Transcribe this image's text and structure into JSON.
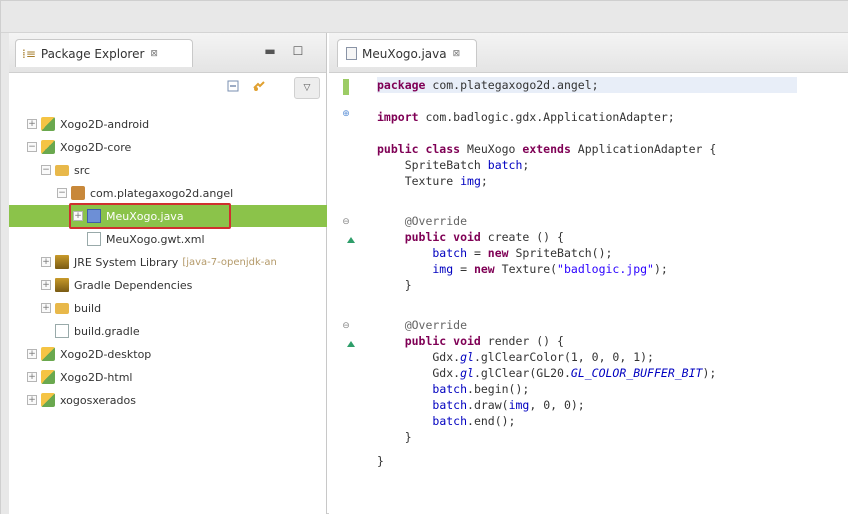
{
  "package_explorer": {
    "tab_label": "Package Explorer",
    "tab_close": "⊠",
    "minimize": "▬",
    "maximize": "☐",
    "toolbar_menu": "▽",
    "tree": [
      {
        "label": "Xogo2D-android",
        "icon": "project-icon",
        "expander": "+"
      },
      {
        "label": "Xogo2D-core",
        "icon": "project-icon",
        "expander": "−"
      },
      {
        "label": "src",
        "icon": "source-folder-icon",
        "expander": "−"
      },
      {
        "label": "com.plategaxogo2d.angel",
        "icon": "package-icon",
        "expander": "−"
      },
      {
        "label": "MeuXogo.java",
        "icon": "java-file-icon",
        "expander": "+",
        "selected": true
      },
      {
        "label": "MeuXogo.gwt.xml",
        "icon": "xml-file-icon",
        "expander": ""
      },
      {
        "label": "JRE System Library",
        "suffix": "[java-7-openjdk-an",
        "icon": "library-icon",
        "expander": "+"
      },
      {
        "label": "Gradle Dependencies",
        "icon": "library-icon",
        "expander": "+"
      },
      {
        "label": "build",
        "icon": "folder-icon",
        "expander": "+"
      },
      {
        "label": "build.gradle",
        "icon": "file-icon",
        "expander": ""
      },
      {
        "label": "Xogo2D-desktop",
        "icon": "project-icon",
        "expander": "+"
      },
      {
        "label": "Xogo2D-html",
        "icon": "project-icon",
        "expander": "+"
      },
      {
        "label": "xogosxerados",
        "icon": "project-icon",
        "expander": "+"
      }
    ]
  },
  "editor": {
    "tab_label": "MeuXogo.java",
    "tab_close": "⊠",
    "code": {
      "l1_kw": "package",
      "l1_rest": " com.plategaxogo2d.angel;",
      "l2_kw": "import",
      "l2_rest": " com.badlogic.gdx.ApplicationAdapter;",
      "l3_kw1": "public class",
      "l3_mid": " MeuXogo ",
      "l3_kw2": "extends",
      "l3_rest": " ApplicationAdapter {",
      "l4_type": "    SpriteBatch ",
      "l4_field": "batch",
      "l4_end": ";",
      "l5_type": "    Texture ",
      "l5_field": "img",
      "l5_end": ";",
      "l6_ann": "    @Override",
      "l7_kw": "    public void",
      "l7_rest": " create () {",
      "l8_field": "        batch",
      "l8_eq": " = ",
      "l8_kw": "new",
      "l8_rest": " SpriteBatch();",
      "l9_field": "        img",
      "l9_eq": " = ",
      "l9_kw": "new",
      "l9_mid": " Texture(",
      "l9_str": "\"badlogic.jpg\"",
      "l9_end": ");",
      "l10": "    }",
      "l11_ann": "    @Override",
      "l12_kw": "    public void",
      "l12_rest": " render () {",
      "l13_a": "        Gdx.",
      "l13_gl": "gl",
      "l13_b": ".glClearColor(1, 0, 0, 1);",
      "l14_a": "        Gdx.",
      "l14_gl": "gl",
      "l14_b": ".glClear(GL20.",
      "l14_const": "GL_COLOR_BUFFER_BIT",
      "l14_c": ");",
      "l15_a": "        ",
      "l15_field": "batch",
      "l15_b": ".begin();",
      "l16_a": "        ",
      "l16_field": "batch",
      "l16_b": ".draw(",
      "l16_field2": "img",
      "l16_c": ", 0, 0);",
      "l17_a": "        ",
      "l17_field": "batch",
      "l17_b": ".end();",
      "l18": "    }",
      "l19": "}"
    }
  },
  "colors": {
    "selection": "#8bc34a",
    "highlight_box": "#d0302f",
    "keyword": "#7f0055",
    "string": "#2a00ff",
    "field": "#0000c0"
  }
}
